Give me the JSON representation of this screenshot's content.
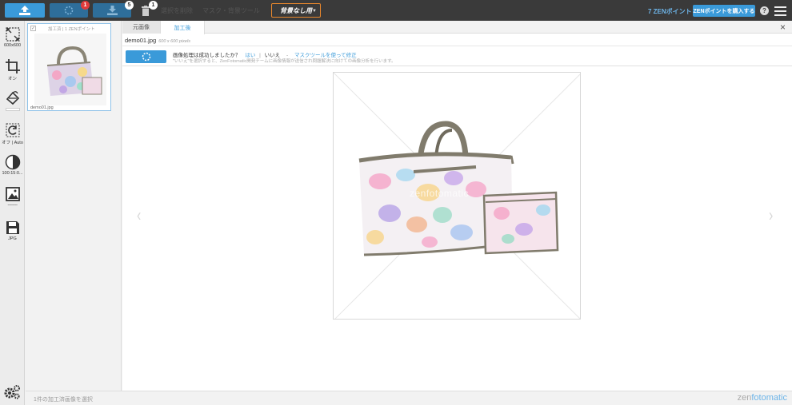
{
  "toolbar": {
    "upload_icon": "upload-icon",
    "process_icon": "spinner-icon",
    "process_badge": "1",
    "download_icon": "download-icon",
    "download_badge": "5",
    "trash_icon": "trash-icon",
    "trash_badge": "1",
    "delete_selected_label": "選択を削除",
    "background_mode_label": "マスク・背景ツール",
    "background_select_label": "背景なし用",
    "points_label": "7 ZENポイント",
    "buy_points_label": "ZENポイントを購入する",
    "help_label": "?",
    "menu_icon": "hamburger-menu-icon"
  },
  "left_tools": [
    {
      "name": "resize",
      "icon": "resize-icon",
      "label": "600x600"
    },
    {
      "name": "crop",
      "icon": "crop-icon",
      "label": "オン"
    },
    {
      "name": "fill",
      "icon": "bucket-icon",
      "label": ""
    },
    {
      "name": "rotate",
      "icon": "rotate-icon",
      "label": "オフ | Auto"
    },
    {
      "name": "levels",
      "icon": "contrast-icon",
      "label": "100:15:0..."
    },
    {
      "name": "shadow",
      "icon": "image-icon",
      "label": "--------"
    },
    {
      "name": "format",
      "icon": "save-icon",
      "label": "JPG"
    }
  ],
  "thumbnail": {
    "header": "加工済 | 1 ZENポイント",
    "filename": "demo01.jpg",
    "checked": true
  },
  "tabs": [
    {
      "label": "元画像",
      "active": false
    },
    {
      "label": "加工後",
      "active": true
    }
  ],
  "file": {
    "name": "demo01.jpg",
    "dimensions": "600 x 600 pixels"
  },
  "confirm": {
    "question": "画像処理は成功しましたか？",
    "yes": "はい",
    "no": "いいえ",
    "dash": "-",
    "mask_link": "マスクツールを使って修正",
    "note": "\"いいえ\"を選択すると、ZenFotomatic開発チームに画像情報が送信され問題解決に向けての画像分析を行います。"
  },
  "canvas": {
    "watermark": "zenfotomatic",
    "prev_arrow": "‹",
    "next_arrow": "›"
  },
  "status": {
    "text": "1件の加工済画像を選択",
    "brand_prefix": "zen",
    "brand_suffix": "fotomatic"
  },
  "colors": {
    "accent": "#3a9ad9",
    "topbar": "#3a3a3a",
    "badge_red": "#e23b3b",
    "select_border": "#e8872c"
  }
}
